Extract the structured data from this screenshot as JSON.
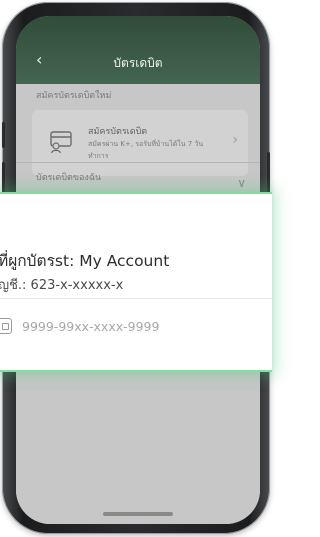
{
  "header": {
    "back_icon": "chevron-left-icon",
    "title": "บัตรเดบิต"
  },
  "apply_section": {
    "heading": "สมัครบัตรเดบิตใหม่",
    "card": {
      "icon": "card-user-icon",
      "title": "สมัครบัตรเดบิต",
      "description": "สมัครผ่าน K+, รอรับที่บ้านได้ใน 7 วันทำการ",
      "chevron": "chevron-right-icon"
    }
  },
  "my_cards_section": {
    "heading": "บัตรเดบิตของฉัน",
    "chevron": "chevron-down-icon"
  },
  "highlight": {
    "account_title": "ที่ผูกบัตรst: My Account",
    "account_number": "ญชี.: 623-x-xxxxx-x",
    "card_icon": "card-icon",
    "card_number": "9999-99xx-xxxx-9999"
  }
}
